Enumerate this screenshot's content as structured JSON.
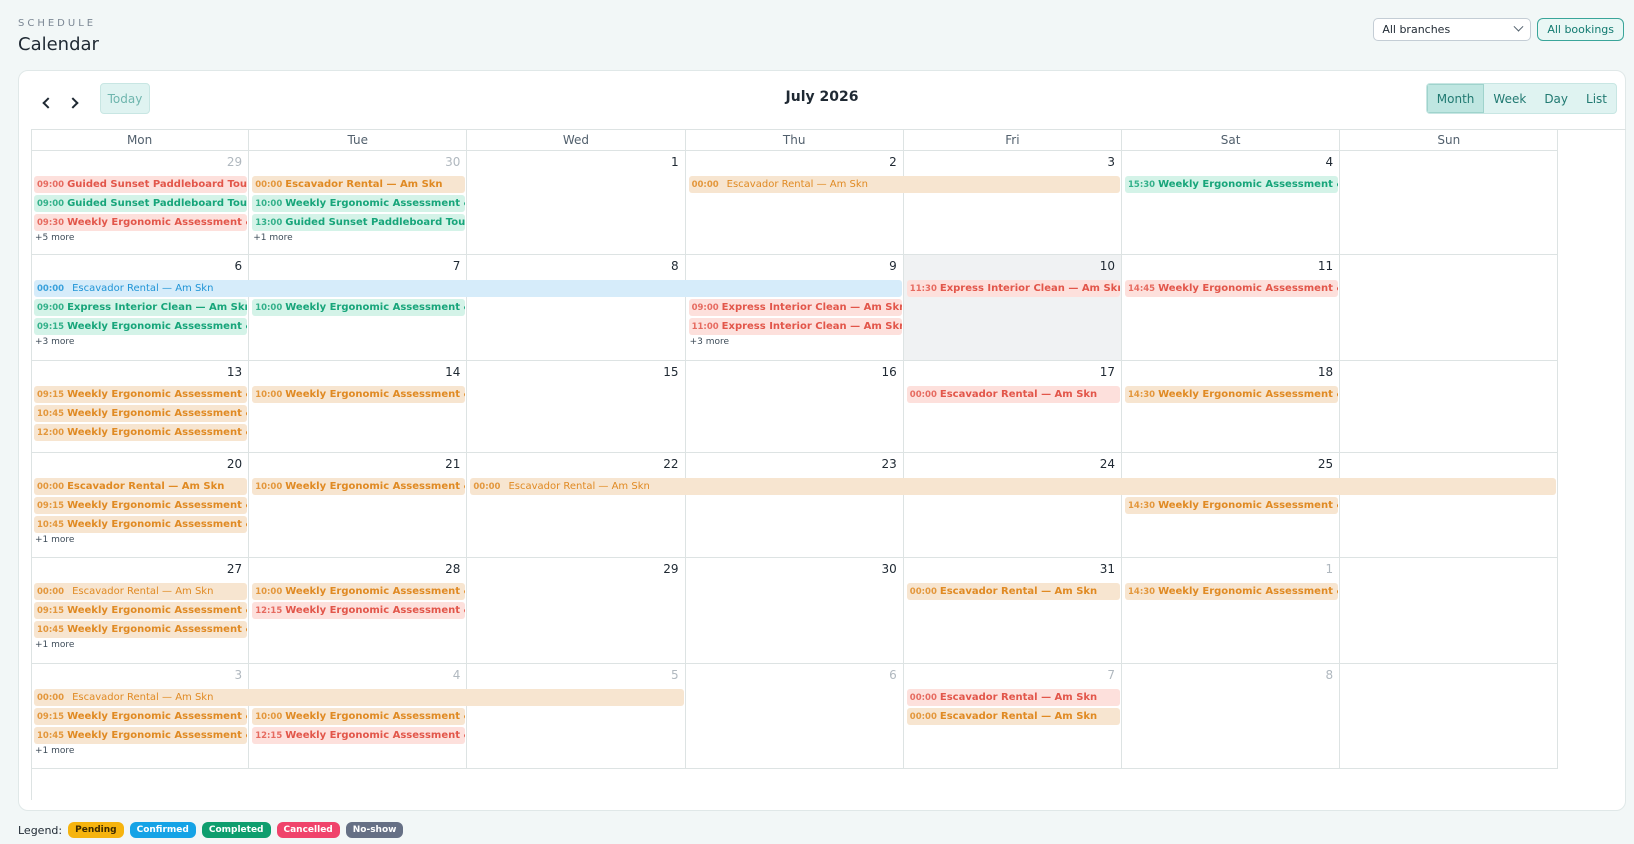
{
  "header": {
    "eyebrow": "SCHEDULE",
    "title": "Calendar"
  },
  "controls": {
    "branch_select": "All branches",
    "all_bookings": "All bookings"
  },
  "toolbar": {
    "today": "Today",
    "month_title": "July 2026",
    "views": [
      "Month",
      "Week",
      "Day",
      "List"
    ],
    "active_view": "Month"
  },
  "days_of_week": [
    "Mon",
    "Tue",
    "Wed",
    "Thu",
    "Fri",
    "Sat",
    "Sun"
  ],
  "weeks": [
    {
      "dates": [
        "29",
        "30",
        "1",
        "2",
        "3",
        "4",
        ""
      ],
      "other": [
        true,
        true,
        false,
        false,
        false,
        false,
        false
      ]
    },
    {
      "dates": [
        "6",
        "7",
        "8",
        "9",
        "10",
        "11",
        ""
      ],
      "other": [
        false,
        false,
        false,
        false,
        false,
        false,
        false
      ]
    },
    {
      "dates": [
        "13",
        "14",
        "15",
        "16",
        "17",
        "18",
        ""
      ],
      "other": [
        false,
        false,
        false,
        false,
        false,
        false,
        false
      ]
    },
    {
      "dates": [
        "20",
        "21",
        "22",
        "23",
        "24",
        "25",
        ""
      ],
      "other": [
        false,
        false,
        false,
        false,
        false,
        false,
        false
      ]
    },
    {
      "dates": [
        "27",
        "28",
        "29",
        "30",
        "31",
        "1",
        ""
      ],
      "other": [
        false,
        false,
        false,
        false,
        false,
        true,
        false
      ]
    },
    {
      "dates": [
        "3",
        "4",
        "5",
        "6",
        "7",
        "8",
        ""
      ],
      "other": [
        true,
        true,
        true,
        true,
        true,
        true,
        false
      ]
    }
  ],
  "events": [
    {
      "week": 0,
      "col": 0,
      "slot": 0,
      "span": 1,
      "time": "09:00",
      "title": "Guided Sunset Paddleboard Tour — Am Skn",
      "color": "pink"
    },
    {
      "week": 0,
      "col": 0,
      "slot": 1,
      "span": 1,
      "time": "09:00",
      "title": "Guided Sunset Paddleboard Tour — Am Skn",
      "color": "green"
    },
    {
      "week": 0,
      "col": 0,
      "slot": 2,
      "span": 1,
      "time": "09:30",
      "title": "Weekly Ergonomic Assessment & Therapy",
      "color": "pink"
    },
    {
      "week": 0,
      "col": 1,
      "slot": 0,
      "span": 1,
      "time": "00:00",
      "title": "Escavador Rental — Am Skn",
      "color": "peach"
    },
    {
      "week": 0,
      "col": 1,
      "slot": 1,
      "span": 1,
      "time": "10:00",
      "title": "Weekly Ergonomic Assessment & Therapy",
      "color": "green"
    },
    {
      "week": 0,
      "col": 1,
      "slot": 2,
      "span": 1,
      "time": "13:00",
      "title": "Guided Sunset Paddleboard Tour — Am Skn",
      "color": "green"
    },
    {
      "week": 0,
      "col": 3,
      "slot": 0,
      "span": 2,
      "time": "00:00",
      "title": "Escavador Rental — Am Skn",
      "color": "peach",
      "spanbar": true
    },
    {
      "week": 0,
      "col": 5,
      "slot": 0,
      "span": 1,
      "time": "15:30",
      "title": "Weekly Ergonomic Assessment & Therapy",
      "color": "green"
    },
    {
      "week": 1,
      "col": 0,
      "slot": 0,
      "span": 4,
      "time": "00:00",
      "title": "Escavador Rental — Am Skn",
      "color": "blue",
      "spanbar": true
    },
    {
      "week": 1,
      "col": 0,
      "slot": 1,
      "span": 1,
      "time": "09:00",
      "title": "Express Interior Clean — Am Skn",
      "color": "green"
    },
    {
      "week": 1,
      "col": 0,
      "slot": 2,
      "span": 1,
      "time": "09:15",
      "title": "Weekly Ergonomic Assessment & Therapy",
      "color": "green"
    },
    {
      "week": 1,
      "col": 1,
      "slot": 1,
      "span": 1,
      "time": "10:00",
      "title": "Weekly Ergonomic Assessment & Therapy",
      "color": "green"
    },
    {
      "week": 1,
      "col": 3,
      "slot": 1,
      "span": 1,
      "time": "09:00",
      "title": "Express Interior Clean — Am Skn",
      "color": "pink"
    },
    {
      "week": 1,
      "col": 3,
      "slot": 2,
      "span": 1,
      "time": "11:00",
      "title": "Express Interior Clean — Am Skn",
      "color": "pink"
    },
    {
      "week": 1,
      "col": 4,
      "slot": 0,
      "span": 1,
      "time": "11:30",
      "title": "Express Interior Clean — Am Skn",
      "color": "pink"
    },
    {
      "week": 1,
      "col": 5,
      "slot": 0,
      "span": 1,
      "time": "14:45",
      "title": "Weekly Ergonomic Assessment & Therapy",
      "color": "pink"
    },
    {
      "week": 2,
      "col": 0,
      "slot": 0,
      "span": 1,
      "time": "09:15",
      "title": "Weekly Ergonomic Assessment & Therapy",
      "color": "peach"
    },
    {
      "week": 2,
      "col": 0,
      "slot": 1,
      "span": 1,
      "time": "10:45",
      "title": "Weekly Ergonomic Assessment & Therapy",
      "color": "peach"
    },
    {
      "week": 2,
      "col": 0,
      "slot": 2,
      "span": 1,
      "time": "12:00",
      "title": "Weekly Ergonomic Assessment & Therapy",
      "color": "peach"
    },
    {
      "week": 2,
      "col": 1,
      "slot": 0,
      "span": 1,
      "time": "10:00",
      "title": "Weekly Ergonomic Assessment & Therapy",
      "color": "peach"
    },
    {
      "week": 2,
      "col": 4,
      "slot": 0,
      "span": 1,
      "time": "00:00",
      "title": "Escavador Rental — Am Skn",
      "color": "pink"
    },
    {
      "week": 2,
      "col": 5,
      "slot": 0,
      "span": 1,
      "time": "14:30",
      "title": "Weekly Ergonomic Assessment & Therapy",
      "color": "peach"
    },
    {
      "week": 3,
      "col": 0,
      "slot": 0,
      "span": 1,
      "time": "00:00",
      "title": "Escavador Rental — Am Skn",
      "color": "peach"
    },
    {
      "week": 3,
      "col": 0,
      "slot": 1,
      "span": 1,
      "time": "09:15",
      "title": "Weekly Ergonomic Assessment & Therapy",
      "color": "peach"
    },
    {
      "week": 3,
      "col": 0,
      "slot": 2,
      "span": 1,
      "time": "10:45",
      "title": "Weekly Ergonomic Assessment & Therapy",
      "color": "peach"
    },
    {
      "week": 3,
      "col": 1,
      "slot": 0,
      "span": 1,
      "time": "10:00",
      "title": "Weekly Ergonomic Assessment & Therapy",
      "color": "peach"
    },
    {
      "week": 3,
      "col": 2,
      "slot": 0,
      "span": 5,
      "time": "00:00",
      "title": "Escavador Rental — Am Skn",
      "color": "peach",
      "spanbar": true
    },
    {
      "week": 3,
      "col": 5,
      "slot": 1,
      "span": 1,
      "time": "14:30",
      "title": "Weekly Ergonomic Assessment & Therapy",
      "color": "peach"
    },
    {
      "week": 4,
      "col": 0,
      "slot": 0,
      "span": 1,
      "time": "00:00",
      "title": "Escavador Rental — Am Skn",
      "color": "peach",
      "spanbar": true
    },
    {
      "week": 4,
      "col": 0,
      "slot": 1,
      "span": 1,
      "time": "09:15",
      "title": "Weekly Ergonomic Assessment & Therapy",
      "color": "peach"
    },
    {
      "week": 4,
      "col": 0,
      "slot": 2,
      "span": 1,
      "time": "10:45",
      "title": "Weekly Ergonomic Assessment & Therapy",
      "color": "peach"
    },
    {
      "week": 4,
      "col": 1,
      "slot": 0,
      "span": 1,
      "time": "10:00",
      "title": "Weekly Ergonomic Assessment & Therapy",
      "color": "peach"
    },
    {
      "week": 4,
      "col": 1,
      "slot": 1,
      "span": 1,
      "time": "12:15",
      "title": "Weekly Ergonomic Assessment & Therapy",
      "color": "pink"
    },
    {
      "week": 4,
      "col": 4,
      "slot": 0,
      "span": 1,
      "time": "00:00",
      "title": "Escavador Rental — Am Skn",
      "color": "peach"
    },
    {
      "week": 4,
      "col": 5,
      "slot": 0,
      "span": 1,
      "time": "14:30",
      "title": "Weekly Ergonomic Assessment & Therapy",
      "color": "peach"
    },
    {
      "week": 5,
      "col": 0,
      "slot": 0,
      "span": 3,
      "time": "00:00",
      "title": "Escavador Rental — Am Skn",
      "color": "peach",
      "spanbar": true
    },
    {
      "week": 5,
      "col": 0,
      "slot": 1,
      "span": 1,
      "time": "09:15",
      "title": "Weekly Ergonomic Assessment & Therapy",
      "color": "peach"
    },
    {
      "week": 5,
      "col": 0,
      "slot": 2,
      "span": 1,
      "time": "10:45",
      "title": "Weekly Ergonomic Assessment & Therapy",
      "color": "peach"
    },
    {
      "week": 5,
      "col": 1,
      "slot": 1,
      "span": 1,
      "time": "10:00",
      "title": "Weekly Ergonomic Assessment & Therapy",
      "color": "peach"
    },
    {
      "week": 5,
      "col": 1,
      "slot": 2,
      "span": 1,
      "time": "12:15",
      "title": "Weekly Ergonomic Assessment & Therapy",
      "color": "pink"
    },
    {
      "week": 5,
      "col": 4,
      "slot": 0,
      "span": 1,
      "time": "00:00",
      "title": "Escavador Rental — Am Skn",
      "color": "pink"
    },
    {
      "week": 5,
      "col": 4,
      "slot": 1,
      "span": 1,
      "time": "00:00",
      "title": "Escavador Rental — Am Skn",
      "color": "peach"
    }
  ],
  "more_links": [
    {
      "week": 0,
      "col": 0,
      "label": "+5 more"
    },
    {
      "week": 0,
      "col": 1,
      "label": "+1 more"
    },
    {
      "week": 1,
      "col": 0,
      "label": "+3 more"
    },
    {
      "week": 1,
      "col": 3,
      "label": "+3 more"
    },
    {
      "week": 3,
      "col": 0,
      "label": "+1 more"
    },
    {
      "week": 4,
      "col": 0,
      "label": "+1 more"
    },
    {
      "week": 5,
      "col": 0,
      "label": "+1 more"
    }
  ],
  "highlighted_cell": {
    "week": 1,
    "col": 4
  },
  "legend": {
    "label": "Legend:",
    "items": [
      {
        "label": "Pending",
        "color": "#f6b40e",
        "text": "#3d2a00"
      },
      {
        "label": "Confirmed",
        "color": "#15a3e6",
        "text": "#ffffff"
      },
      {
        "label": "Completed",
        "color": "#0e9e6e",
        "text": "#ffffff"
      },
      {
        "label": "Cancelled",
        "color": "#f0436b",
        "text": "#ffffff"
      },
      {
        "label": "No-show",
        "color": "#667085",
        "text": "#ffffff"
      }
    ]
  }
}
